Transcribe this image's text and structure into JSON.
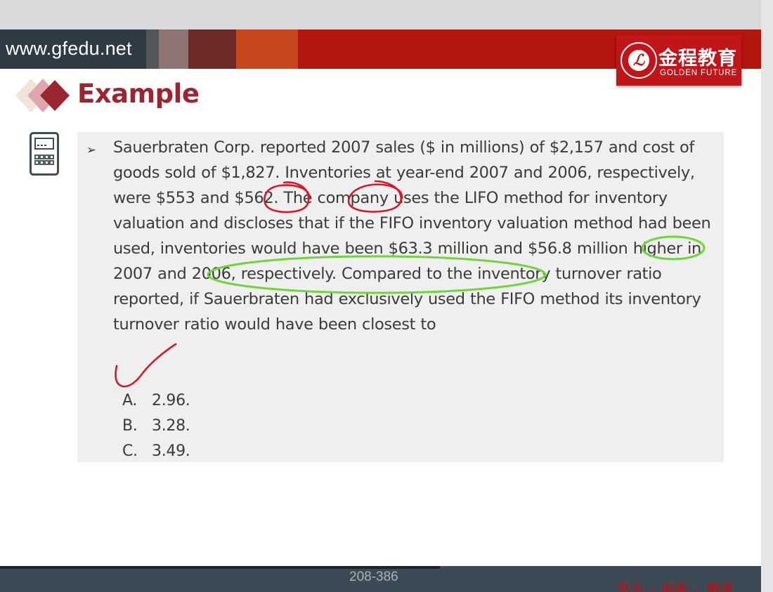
{
  "site": {
    "url": "www.gfedu.net"
  },
  "logo": {
    "chinese": "金程教育",
    "english": "GOLDEN FUTURE",
    "seal_glyph": "ℒ"
  },
  "page_title": "Example",
  "question": {
    "bullet": "➢",
    "text": "Sauerbraten Corp. reported 2007 sales ($ in millions) of $2,157 and cost of goods sold of $1,827. Inventories at year-end 2007 and 2006, respectively, were $553 and $562. The company uses the LIFO method for inventory valuation and discloses that if the FIFO inventory valuation method had been used, inventories would have been $63.3 million and $56.8 million higher in 2007 and 2006, respectively. Compared to the inventory turnover ratio reported, if Sauerbraten had exclusively used the FIFO method its inventory turnover ratio would have been closest to",
    "options": [
      {
        "label": "A.",
        "value": "2.96."
      },
      {
        "label": "B.",
        "value": "3.28."
      },
      {
        "label": "C.",
        "value": "3.49."
      }
    ]
  },
  "footer": {
    "page_number": "208-386",
    "slogan": "专业 · 创新 · 增值"
  },
  "colors": {
    "banner_red": "#b3150f",
    "banner_orange": "#cc3f12",
    "logo_red": "#c1151a",
    "title_red": "#9b2630",
    "annotation_red": "#d21a2a",
    "annotation_green": "#6ed63a",
    "footer_navy": "#3c4a55"
  },
  "icons": {
    "arrow_bullet": "arrow-bullet-icon",
    "calculator": "calculator-icon",
    "title_diamonds": "diamond-decoration-icon"
  }
}
